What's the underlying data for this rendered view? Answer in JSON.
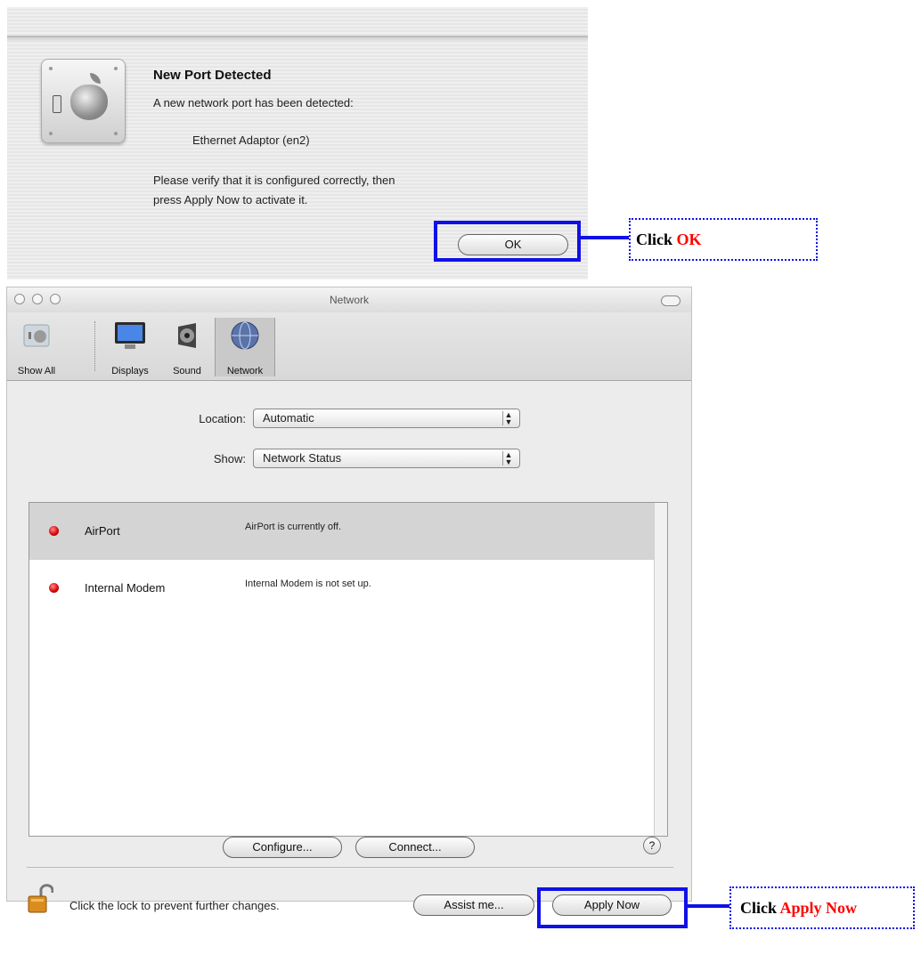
{
  "sheet": {
    "title": "New Port Detected",
    "line1": "A new network port has been detected:",
    "port_name": "Ethernet Adaptor (en2)",
    "line2": "Please verify that it is configured correctly, then",
    "line3": "press Apply Now to activate it.",
    "ok_label": "OK"
  },
  "callouts": {
    "ok": {
      "prefix": "Click ",
      "highlight": "OK"
    },
    "apply": {
      "prefix": "Click ",
      "highlight": "Apply Now"
    }
  },
  "window": {
    "title": "Network",
    "toolbar": [
      {
        "label": "Show All",
        "icon": "show-all-icon"
      },
      {
        "label": "Displays",
        "icon": "displays-icon"
      },
      {
        "label": "Sound",
        "icon": "sound-icon"
      },
      {
        "label": "Network",
        "icon": "network-icon"
      }
    ],
    "location": {
      "label": "Location:",
      "value": "Automatic"
    },
    "show": {
      "label": "Show:",
      "value": "Network Status"
    },
    "status_rows": [
      {
        "name": "AirPort",
        "message": "AirPort is currently off."
      },
      {
        "name": "Internal Modem",
        "message": "Internal Modem is not set up."
      }
    ],
    "configure_label": "Configure...",
    "connect_label": "Connect...",
    "help_label": "?",
    "lock_text": "Click the lock to prevent further changes.",
    "assist_label": "Assist me...",
    "apply_label": "Apply Now"
  },
  "colors": {
    "callout_blue": "#1010e8",
    "callout_red": "#ff0000",
    "status_red": "#d40000",
    "window_bg": "#ececec",
    "selected_row": "#d4d4d4"
  }
}
